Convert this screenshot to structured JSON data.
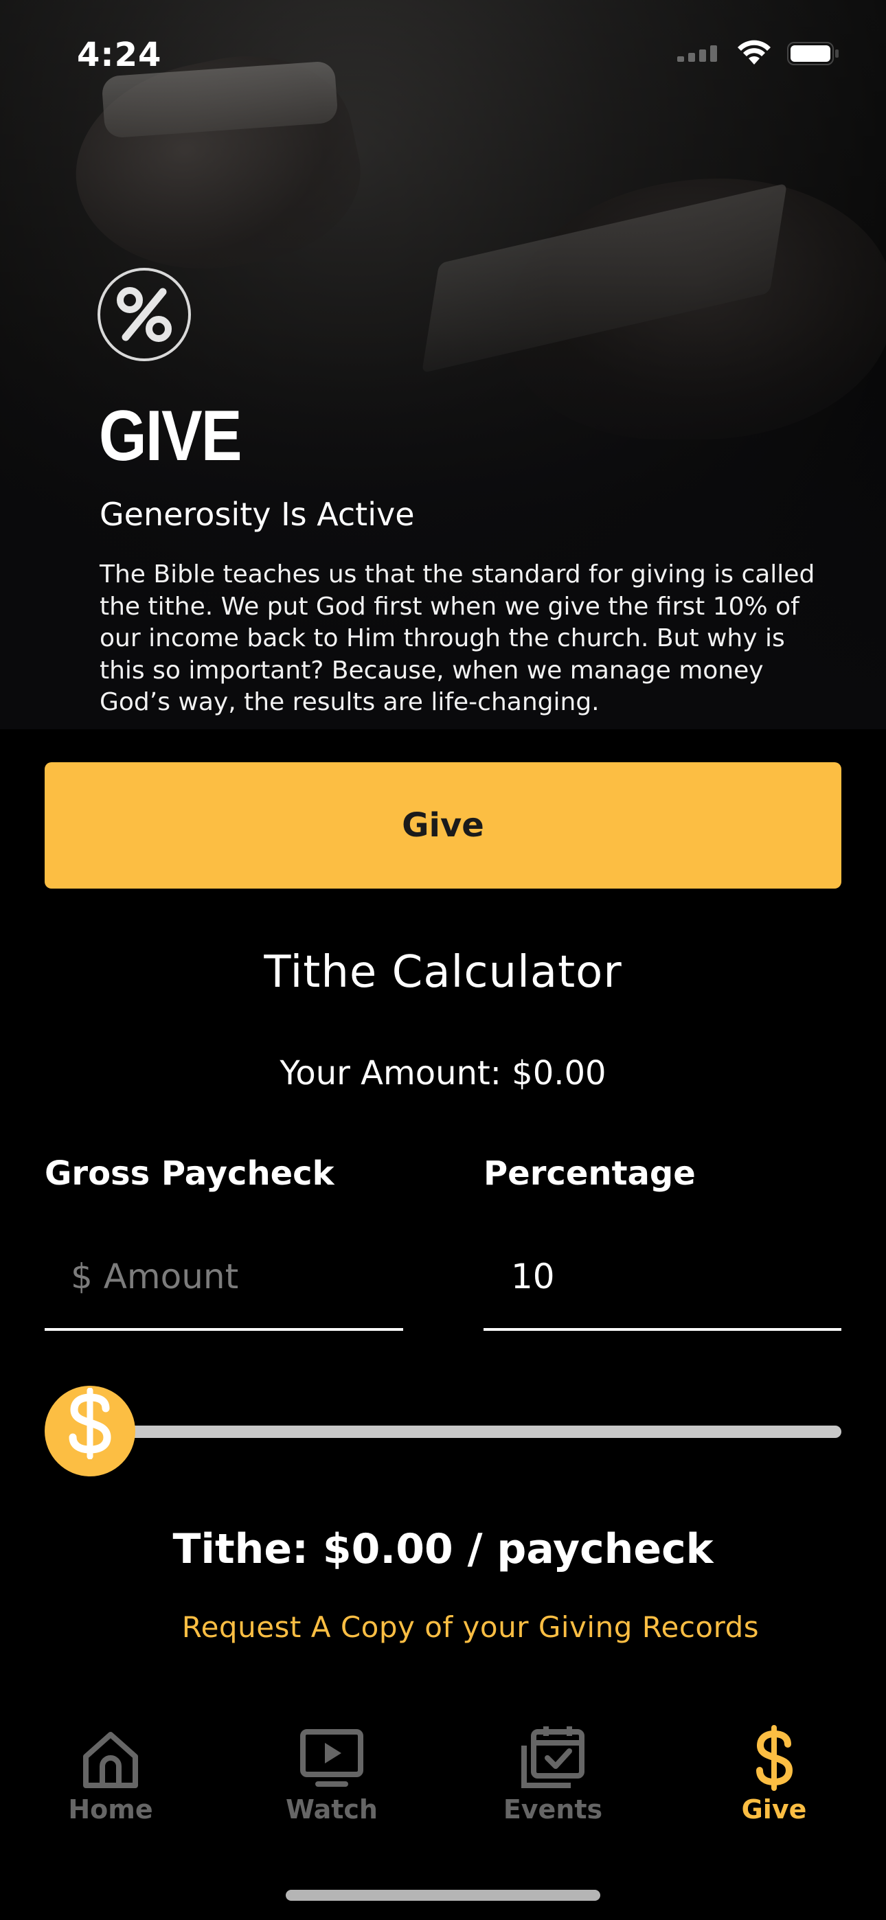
{
  "status_bar": {
    "time": "4:24"
  },
  "hero": {
    "badge_icon": "percent-icon",
    "title": "GIVE",
    "subtitle": "Generosity Is Active",
    "body": "The Bible teaches us that the standard for giving is called the tithe. We put God first when we give the first 10% of our income back to Him through the church. But why is this so important? Because, when we manage money God’s way, the results are life-changing."
  },
  "give_button": {
    "label": "Give"
  },
  "calculator": {
    "title": "Tithe Calculator",
    "your_amount": "Your Amount: $0.00",
    "gross_label": "Gross Paycheck",
    "gross_placeholder": "$ Amount",
    "gross_value": "",
    "percentage_label": "Percentage",
    "percentage_value": "10",
    "slider_value": 0,
    "slider_icon": "dollar-icon",
    "result": "Tithe: $0.00 / paycheck",
    "records_link": "Request A Copy of your Giving Records"
  },
  "tabs": [
    {
      "label": "Home",
      "icon": "home-icon",
      "active": false
    },
    {
      "label": "Watch",
      "icon": "video-icon",
      "active": false
    },
    {
      "label": "Events",
      "icon": "calendar-icon",
      "active": false
    },
    {
      "label": "Give",
      "icon": "dollar-icon",
      "active": true
    }
  ],
  "colors": {
    "accent": "#fcbe43",
    "background": "#000000",
    "tab_inactive": "#666666"
  }
}
